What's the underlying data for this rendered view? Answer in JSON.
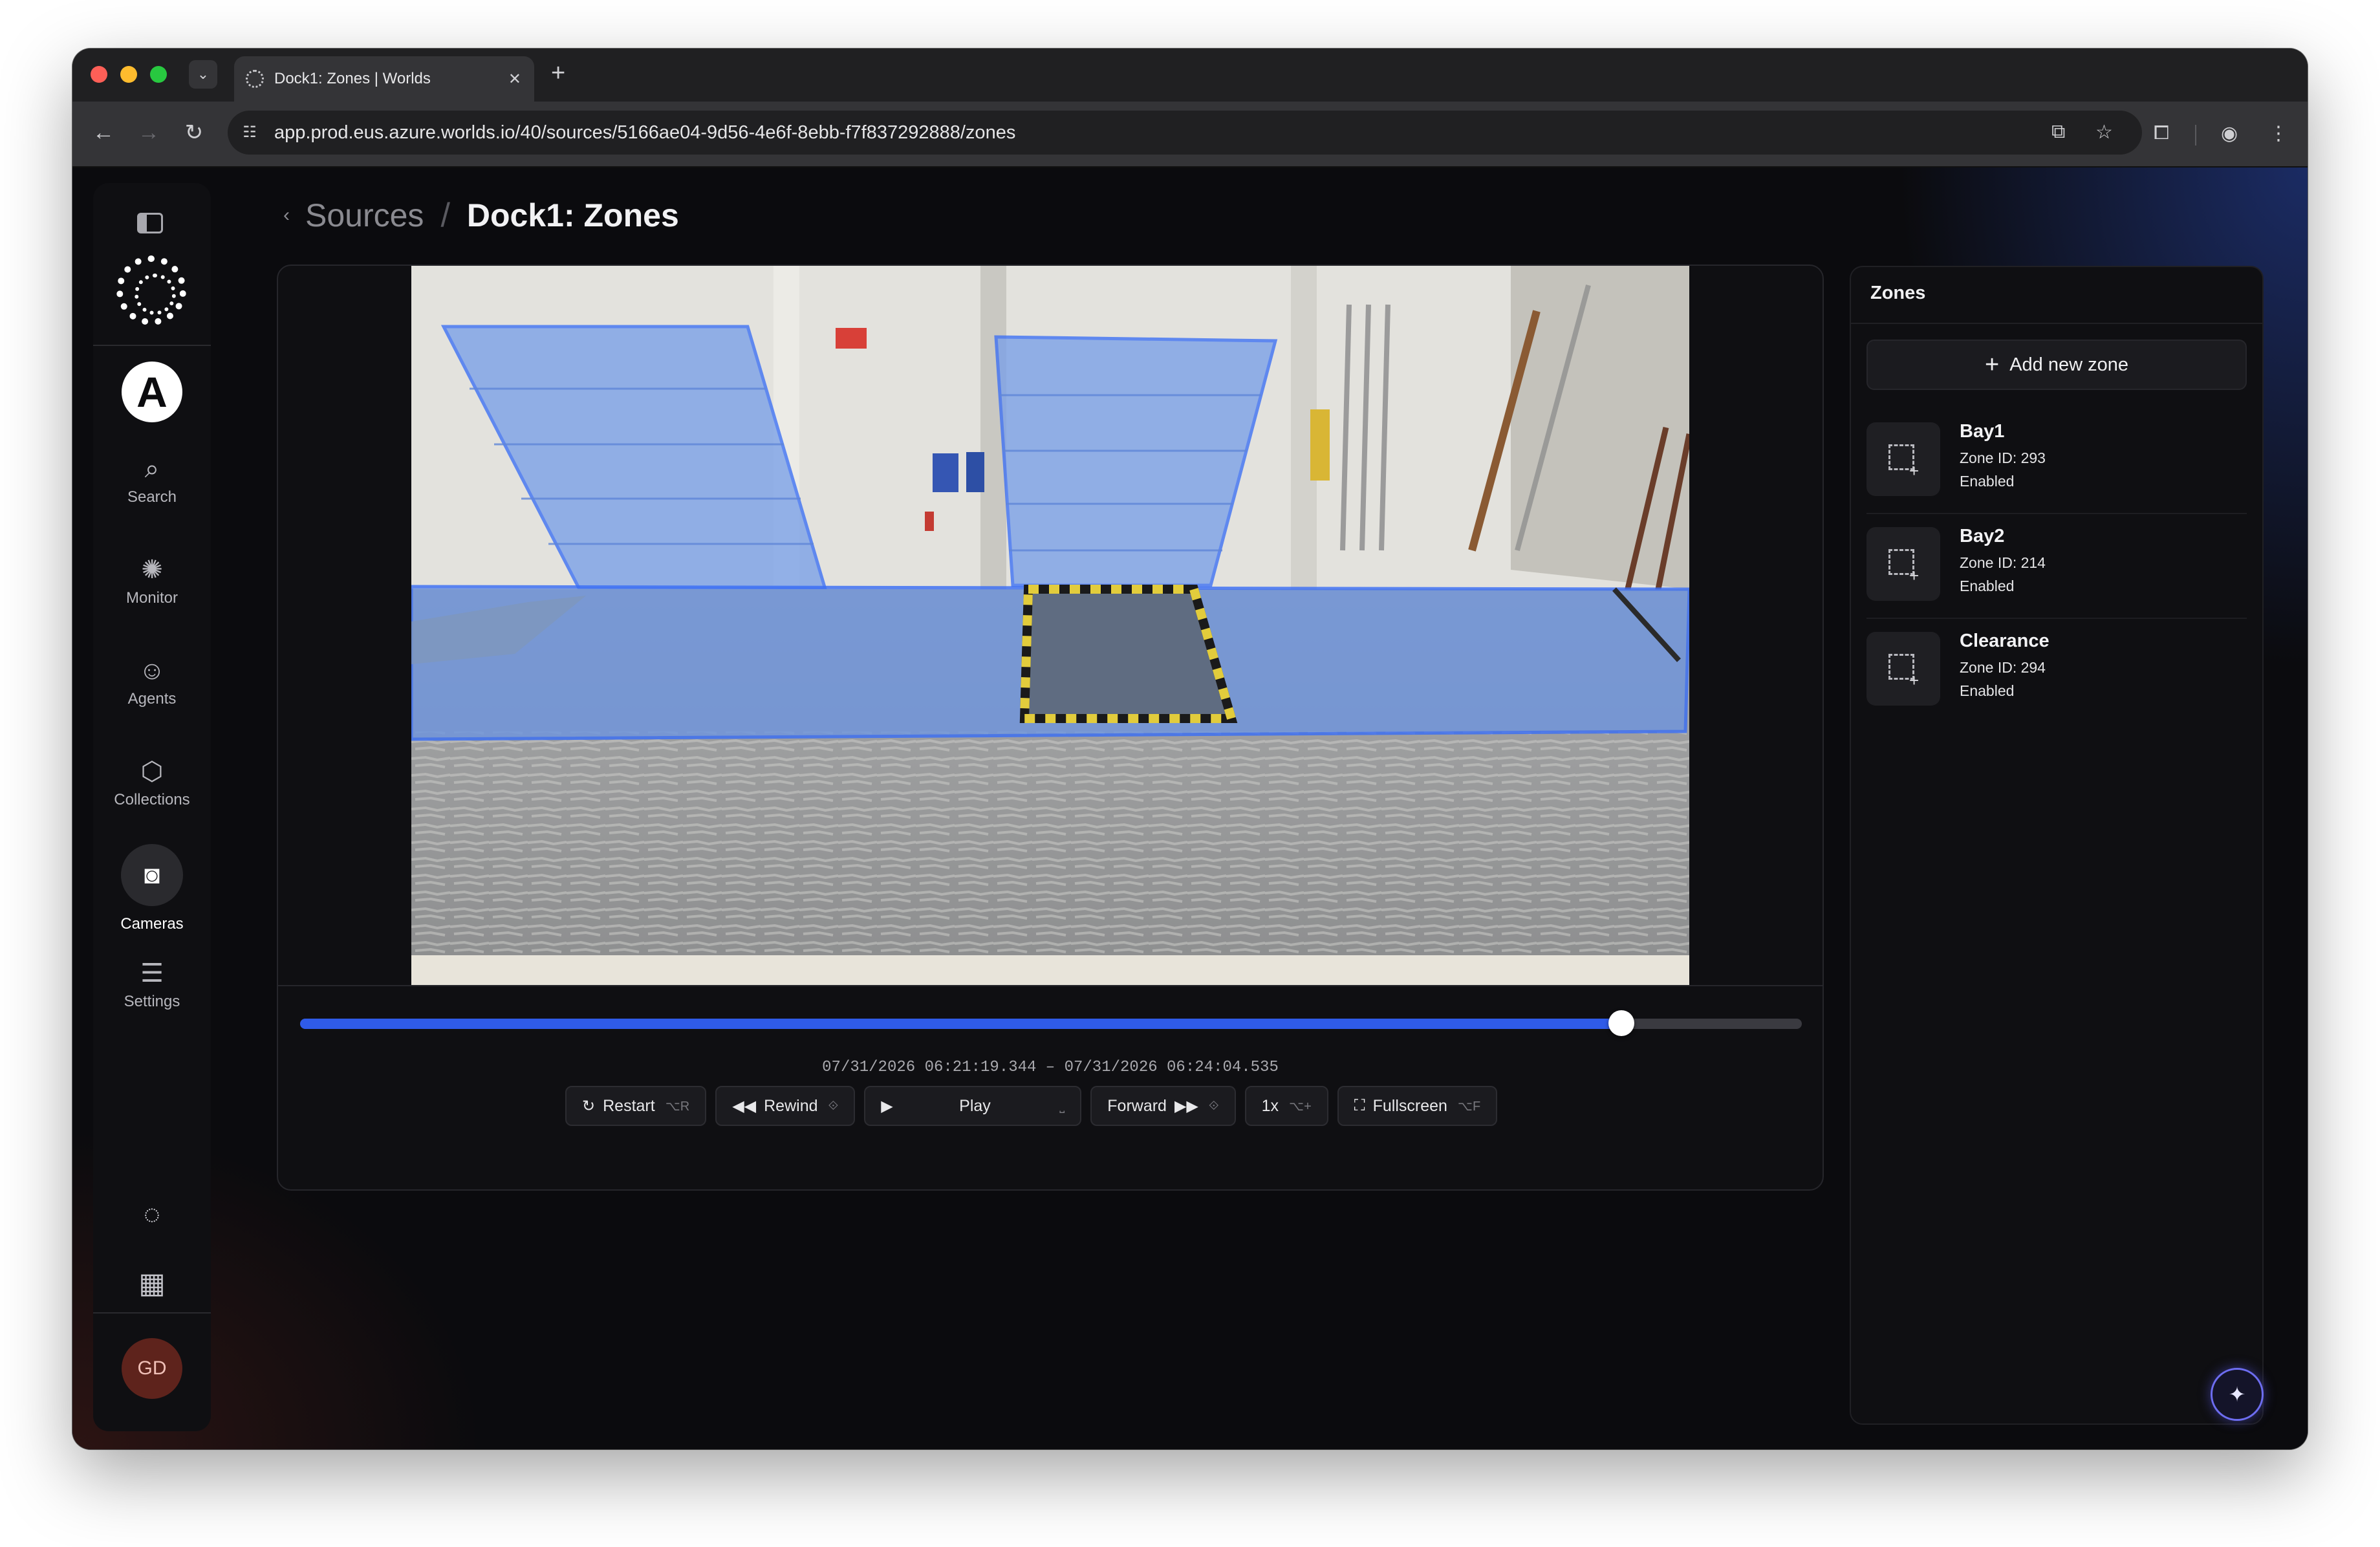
{
  "browser": {
    "tab_title": "Dock1: Zones | Worlds",
    "url": "app.prod.eus.azure.worlds.io/40/sources/5166ae04-9d56-4e6f-8ebb-f7f837292888/zones"
  },
  "sidebar": {
    "org_initial": "A",
    "items": [
      {
        "label": "Search",
        "icon": "search-icon"
      },
      {
        "label": "Monitor",
        "icon": "monitor-icon"
      },
      {
        "label": "Agents",
        "icon": "robot-icon"
      },
      {
        "label": "Collections",
        "icon": "cube-icon"
      },
      {
        "label": "Cameras",
        "icon": "camera-icon",
        "active": true
      },
      {
        "label": "Settings",
        "icon": "sliders-icon"
      }
    ],
    "user_initials": "GD"
  },
  "breadcrumb": {
    "parent": "Sources",
    "current": "Dock1: Zones"
  },
  "player": {
    "progress_fraction": 0.88,
    "time_range": "07/31/2026 06:21:19.344 – 07/31/2026 06:24:04.535",
    "controls": [
      {
        "label": "Restart",
        "shortcut": "⌥R",
        "icon": "restart-icon"
      },
      {
        "label": "Rewind",
        "shortcut": "⟐",
        "icon": "rewind-icon"
      },
      {
        "label": "Play",
        "shortcut": "⎵",
        "icon": "play-icon"
      },
      {
        "label": "Forward",
        "shortcut": "⟐",
        "icon": "forward-icon"
      },
      {
        "label": "1x",
        "shortcut": "⌥+",
        "icon": ""
      },
      {
        "label": "Fullscreen",
        "shortcut": "⌥F",
        "icon": "fullscreen-icon"
      }
    ]
  },
  "zones_panel": {
    "title": "Zones",
    "add_label": "Add new zone",
    "zones": [
      {
        "name": "Bay1",
        "zone_id": "Zone ID: 293",
        "status": "Enabled"
      },
      {
        "name": "Bay2",
        "zone_id": "Zone ID: 214",
        "status": "Enabled"
      },
      {
        "name": "Clearance",
        "zone_id": "Zone ID: 294",
        "status": "Enabled"
      }
    ]
  },
  "colors": {
    "accent": "#2f5be8",
    "zone_fill": "#7aa0e8",
    "zone_stroke": "#3b6ff5"
  }
}
